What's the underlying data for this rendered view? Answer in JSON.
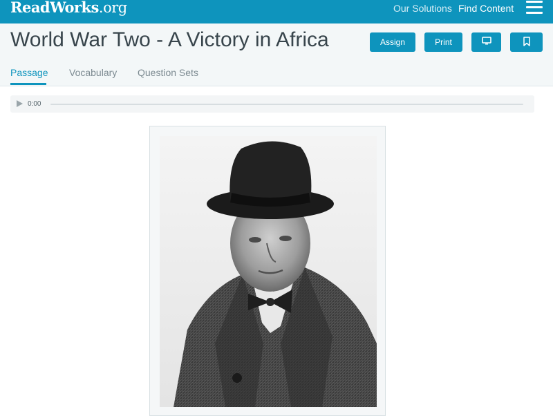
{
  "brand": {
    "logo_text": "ReadWorks",
    "logo_suffix": ".org"
  },
  "topnav": {
    "our_solutions": "Our Solutions",
    "find_content": "Find Content",
    "menu_icon": "hamburger-menu-icon"
  },
  "page": {
    "title": "World War Two - A Victory in Africa"
  },
  "actions": {
    "assign": "Assign",
    "print": "Print",
    "projector_icon": "monitor-icon",
    "bookmark_icon": "bookmark-icon"
  },
  "tabs": [
    {
      "label": "Passage",
      "active": true
    },
    {
      "label": "Vocabulary",
      "active": false
    },
    {
      "label": "Question Sets",
      "active": false
    }
  ],
  "audio": {
    "time": "0:00",
    "progress": 0
  },
  "figure": {
    "subject": "black-and-white portrait photograph of a man in a top hat and overcoat"
  },
  "colors": {
    "accent": "#0e94bd",
    "header_bg": "#f3f7f8",
    "title": "#38454c"
  }
}
